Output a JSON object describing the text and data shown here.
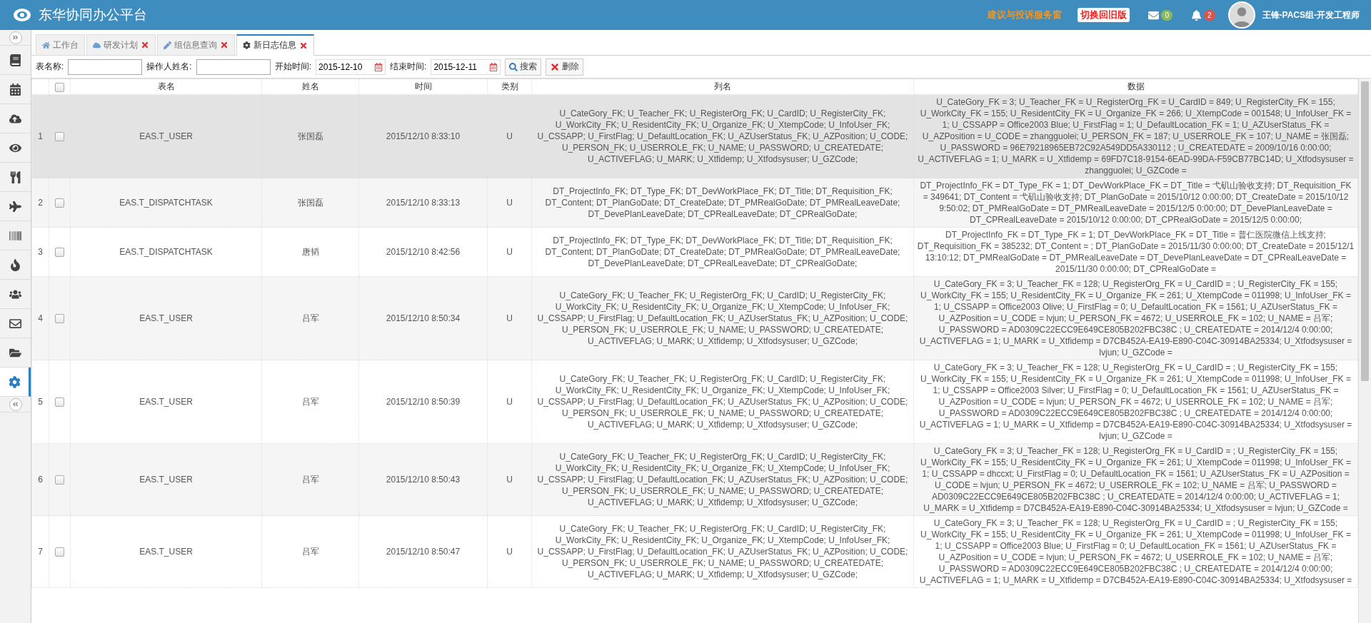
{
  "header": {
    "title": "东华协同办公平台",
    "links": [
      {
        "label": "建议与投诉服务窗",
        "color": "#f7941d"
      },
      {
        "label": "切换回旧版",
        "color": "#ff1a1a"
      }
    ],
    "notifications": [
      {
        "kind": "mail",
        "badge": "0"
      },
      {
        "kind": "bell",
        "badge": "2"
      }
    ],
    "user": "王锋-PACS组-开发工程师"
  },
  "sidebar": {
    "items": [
      {
        "kind": "book",
        "selected": false
      },
      {
        "kind": "calendar",
        "selected": false
      },
      {
        "kind": "upload",
        "selected": false
      },
      {
        "kind": "eye",
        "selected": false
      },
      {
        "kind": "utensils",
        "selected": false
      },
      {
        "kind": "plane",
        "selected": false
      },
      {
        "kind": "barcode",
        "selected": false
      },
      {
        "kind": "fire",
        "selected": false
      },
      {
        "kind": "users",
        "selected": false
      },
      {
        "kind": "envelope",
        "selected": false
      },
      {
        "kind": "folder",
        "selected": false
      },
      {
        "kind": "gear",
        "selected": true
      }
    ]
  },
  "tabs": [
    {
      "label": "工作台",
      "kind": "home",
      "closable": false,
      "selected": false
    },
    {
      "label": "研发计划",
      "kind": "cloud",
      "closable": true,
      "selected": false
    },
    {
      "label": "组信息查询",
      "kind": "pen",
      "closable": true,
      "selected": false
    },
    {
      "label": "新日志信息",
      "kind": "gear",
      "closable": true,
      "selected": true
    }
  ],
  "filters": [
    {
      "label": "表名称:",
      "kind": "text"
    },
    {
      "label": "操作人姓名:",
      "kind": "text"
    },
    {
      "label": "开始时间:",
      "kind": "date",
      "value": "2015-12-10"
    },
    {
      "label": "结束时间:",
      "kind": "date",
      "value": "2015-12-11"
    }
  ],
  "buttons": [
    {
      "label": "搜索",
      "kind": "search"
    },
    {
      "label": "删除",
      "kind": "delete"
    }
  ],
  "table": {
    "header_checkbox": {
      "checked": false
    },
    "columns": [
      "表名",
      "姓名",
      "时间",
      "类别",
      "列名",
      "数据"
    ],
    "rows": [
      {
        "number": "1",
        "checked": false,
        "selected": true,
        "table": "EAS.T_USER",
        "name": "张国磊",
        "time": "2015/12/10 8:33:10",
        "type": "U",
        "fields": "U_CateGory_FK; U_Teacher_FK; U_RegisterOrg_FK; U_CardID; U_RegisterCity_FK; U_WorkCity_FK; U_ResidentCity_FK; U_Organize_FK; U_XtempCode; U_InfoUser_FK; U_CSSAPP; U_FirstFlag; U_DefaultLocation_FK; U_AZUserStatus_FK; U_AZPosition; U_CODE; U_PERSON_FK; U_USERROLE_FK; U_NAME; U_PASSWORD; U_CREATEDATE; U_ACTIVEFLAG; U_MARK; U_Xtfidemp; U_Xtfodsysuser; U_GZCode;",
        "data": "U_CateGory_FK = 3; U_Teacher_FK = U_RegisterOrg_FK = U_CardID = 849; U_RegisterCity_FK = 155; U_WorkCity_FK = 155; U_ResidentCity_FK = U_Organize_FK = 266; U_XtempCode = 001548; U_InfoUser_FK = 1; U_CSSAPP = Office2003 Blue; U_FirstFlag = 1; U_DefaultLocation_FK = 1; U_AZUserStatus_FK = U_AZPosition = U_CODE = zhangguolei; U_PERSON_FK = 187; U_USERROLE_FK = 107; U_NAME = 张国磊; U_PASSWORD = 96E79218965EB72C92A549DD5A330112 ; U_CREATEDATE = 2009/10/16 0:00:00; U_ACTIVEFLAG = 1; U_MARK = U_Xtfidemp = 69FD7C18-9154-6EAD-99DA-F59CB77BC14D; U_Xtfodsysuser = zhangguolei; U_GZCode ="
      },
      {
        "number": "2",
        "checked": false,
        "selected": false,
        "table": "EAS.T_DISPATCHTASK",
        "name": "张国磊",
        "time": "2015/12/10 8:33:13",
        "type": "U",
        "fields": "DT_ProjectInfo_FK; DT_Type_FK; DT_DevWorkPlace_FK; DT_Title; DT_Requisition_FK; DT_Content; DT_PlanGoDate; DT_CreateDate; DT_PMRealGoDate; DT_PMRealLeaveDate; DT_DevePlanLeaveDate; DT_CPRealLeaveDate; DT_CPRealGoDate;",
        "data": "DT_ProjectInfo_FK = DT_Type_FK = 1; DT_DevWorkPlace_FK = DT_Title = 弋矶山验收支持; DT_Requisition_FK = 349641; DT_Content = 弋矶山验收支持; DT_PlanGoDate = 2015/10/12 0:00:00; DT_CreateDate = 2015/10/12 9:50:02; DT_PMRealGoDate = DT_PMRealLeaveDate = 2015/12/5 0:00:00; DT_DevePlanLeaveDate = DT_CPRealLeaveDate = 2015/10/12 0:00:00; DT_CPRealGoDate = 2015/12/5 0:00:00;"
      },
      {
        "number": "3",
        "checked": false,
        "selected": false,
        "table": "EAS.T_DISPATCHTASK",
        "name": "唐韬",
        "time": "2015/12/10 8:42:56",
        "type": "U",
        "fields": "DT_ProjectInfo_FK; DT_Type_FK; DT_DevWorkPlace_FK; DT_Title; DT_Requisition_FK; DT_Content; DT_PlanGoDate; DT_CreateDate; DT_PMRealGoDate; DT_PMRealLeaveDate; DT_DevePlanLeaveDate; DT_CPRealLeaveDate; DT_CPRealGoDate;",
        "data": "DT_ProjectInfo_FK = DT_Type_FK = 1; DT_DevWorkPlace_FK = DT_Title = 普仁医院微信上线支持; DT_Requisition_FK = 385232; DT_Content = ; DT_PlanGoDate = 2015/11/30 0:00:00; DT_CreateDate = 2015/12/1 13:10:12; DT_PMRealGoDate = DT_PMRealLeaveDate = DT_DevePlanLeaveDate = DT_CPRealLeaveDate = 2015/11/30 0:00:00; DT_CPRealGoDate ="
      },
      {
        "number": "4",
        "checked": false,
        "selected": false,
        "table": "EAS.T_USER",
        "name": "吕军",
        "time": "2015/12/10 8:50:34",
        "type": "U",
        "fields": "U_CateGory_FK; U_Teacher_FK; U_RegisterOrg_FK; U_CardID; U_RegisterCity_FK; U_WorkCity_FK; U_ResidentCity_FK; U_Organize_FK; U_XtempCode; U_InfoUser_FK; U_CSSAPP; U_FirstFlag; U_DefaultLocation_FK; U_AZUserStatus_FK; U_AZPosition; U_CODE; U_PERSON_FK; U_USERROLE_FK; U_NAME; U_PASSWORD; U_CREATEDATE; U_ACTIVEFLAG; U_MARK; U_Xtfidemp; U_Xtfodsysuser; U_GZCode;",
        "data": "U_CateGory_FK = 3; U_Teacher_FK = 128; U_RegisterOrg_FK = U_CardID = ; U_RegisterCity_FK = 155; U_WorkCity_FK = 155; U_ResidentCity_FK = U_Organize_FK = 261; U_XtempCode = 011998; U_InfoUser_FK = 1; U_CSSAPP = Office2003 Olive; U_FirstFlag = 0; U_DefaultLocation_FK = 1561; U_AZUserStatus_FK = U_AZPosition = U_CODE = lvjun; U_PERSON_FK = 4672; U_USERROLE_FK = 102; U_NAME = 吕军; U_PASSWORD = AD0309C22ECC9E649CE805B202FBC38C ; U_CREATEDATE = 2014/12/4 0:00:00; U_ACTIVEFLAG = 1; U_MARK = U_Xtfidemp = D7CB452A-EA19-E890-C04C-30914BA25334; U_Xtfodsysuser = lvjun; U_GZCode ="
      },
      {
        "number": "5",
        "checked": false,
        "selected": false,
        "table": "EAS.T_USER",
        "name": "吕军",
        "time": "2015/12/10 8:50:39",
        "type": "U",
        "fields": "U_CateGory_FK; U_Teacher_FK; U_RegisterOrg_FK; U_CardID; U_RegisterCity_FK; U_WorkCity_FK; U_ResidentCity_FK; U_Organize_FK; U_XtempCode; U_InfoUser_FK; U_CSSAPP; U_FirstFlag; U_DefaultLocation_FK; U_AZUserStatus_FK; U_AZPosition; U_CODE; U_PERSON_FK; U_USERROLE_FK; U_NAME; U_PASSWORD; U_CREATEDATE; U_ACTIVEFLAG; U_MARK; U_Xtfidemp; U_Xtfodsysuser; U_GZCode;",
        "data": "U_CateGory_FK = 3; U_Teacher_FK = 128; U_RegisterOrg_FK = U_CardID = ; U_RegisterCity_FK = 155; U_WorkCity_FK = 155; U_ResidentCity_FK = U_Organize_FK = 261; U_XtempCode = 011998; U_InfoUser_FK = 1; U_CSSAPP = Office2003 Silver; U_FirstFlag = 0; U_DefaultLocation_FK = 1561; U_AZUserStatus_FK = U_AZPosition = U_CODE = lvjun; U_PERSON_FK = 4672; U_USERROLE_FK = 102; U_NAME = 吕军; U_PASSWORD = AD0309C22ECC9E649CE805B202FBC38C ; U_CREATEDATE = 2014/12/4 0:00:00; U_ACTIVEFLAG = 1; U_MARK = U_Xtfidemp = D7CB452A-EA19-E890-C04C-30914BA25334; U_Xtfodsysuser = lvjun; U_GZCode ="
      },
      {
        "number": "6",
        "checked": false,
        "selected": false,
        "table": "EAS.T_USER",
        "name": "吕军",
        "time": "2015/12/10 8:50:43",
        "type": "U",
        "fields": "U_CateGory_FK; U_Teacher_FK; U_RegisterOrg_FK; U_CardID; U_RegisterCity_FK; U_WorkCity_FK; U_ResidentCity_FK; U_Organize_FK; U_XtempCode; U_InfoUser_FK; U_CSSAPP; U_FirstFlag; U_DefaultLocation_FK; U_AZUserStatus_FK; U_AZPosition; U_CODE; U_PERSON_FK; U_USERROLE_FK; U_NAME; U_PASSWORD; U_CREATEDATE; U_ACTIVEFLAG; U_MARK; U_Xtfidemp; U_Xtfodsysuser; U_GZCode;",
        "data": "U_CateGory_FK = 3; U_Teacher_FK = 128; U_RegisterOrg_FK = U_CardID = ; U_RegisterCity_FK = 155; U_WorkCity_FK = 155; U_ResidentCity_FK = U_Organize_FK = 261; U_XtempCode = 011998; U_InfoUser_FK = 1; U_CSSAPP = dhccxt; U_FirstFlag = 0; U_DefaultLocation_FK = 1561; U_AZUserStatus_FK = U_AZPosition = U_CODE = lvjun; U_PERSON_FK = 4672; U_USERROLE_FK = 102; U_NAME = 吕军; U_PASSWORD = AD0309C22ECC9E649CE805B202FBC38C ; U_CREATEDATE = 2014/12/4 0:00:00; U_ACTIVEFLAG = 1; U_MARK = U_Xtfidemp = D7CB452A-EA19-E890-C04C-30914BA25334; U_Xtfodsysuser = lvjun; U_GZCode ="
      },
      {
        "number": "7",
        "checked": false,
        "selected": false,
        "table": "EAS.T_USER",
        "name": "吕军",
        "time": "2015/12/10 8:50:47",
        "type": "U",
        "fields": "U_CateGory_FK; U_Teacher_FK; U_RegisterOrg_FK; U_CardID; U_RegisterCity_FK; U_WorkCity_FK; U_ResidentCity_FK; U_Organize_FK; U_XtempCode; U_InfoUser_FK; U_CSSAPP; U_FirstFlag; U_DefaultLocation_FK; U_AZUserStatus_FK; U_AZPosition; U_CODE; U_PERSON_FK; U_USERROLE_FK; U_NAME; U_PASSWORD; U_CREATEDATE; U_ACTIVEFLAG; U_MARK; U_Xtfidemp; U_Xtfodsysuser; U_GZCode;",
        "data": "U_CateGory_FK = 3; U_Teacher_FK = 128; U_RegisterOrg_FK = U_CardID = ; U_RegisterCity_FK = 155; U_WorkCity_FK = 155; U_ResidentCity_FK = U_Organize_FK = 261; U_XtempCode = 011998; U_InfoUser_FK = 1; U_CSSAPP = Office2003 Blue; U_FirstFlag = 0; U_DefaultLocation_FK = 1561; U_AZUserStatus_FK = U_AZPosition = U_CODE = lvjun; U_PERSON_FK = 4672; U_USERROLE_FK = 102; U_NAME = 吕军; U_PASSWORD = AD0309C22ECC9E649CE805B202FBC38C ; U_CREATEDATE = 2014/12/4 0:00:00; U_ACTIVEFLAG = 1; U_MARK = U_Xtfidemp = D7CB452A-EA19-E890-C04C-30914BA25334; U_Xtfodsysuser ="
      }
    ]
  }
}
